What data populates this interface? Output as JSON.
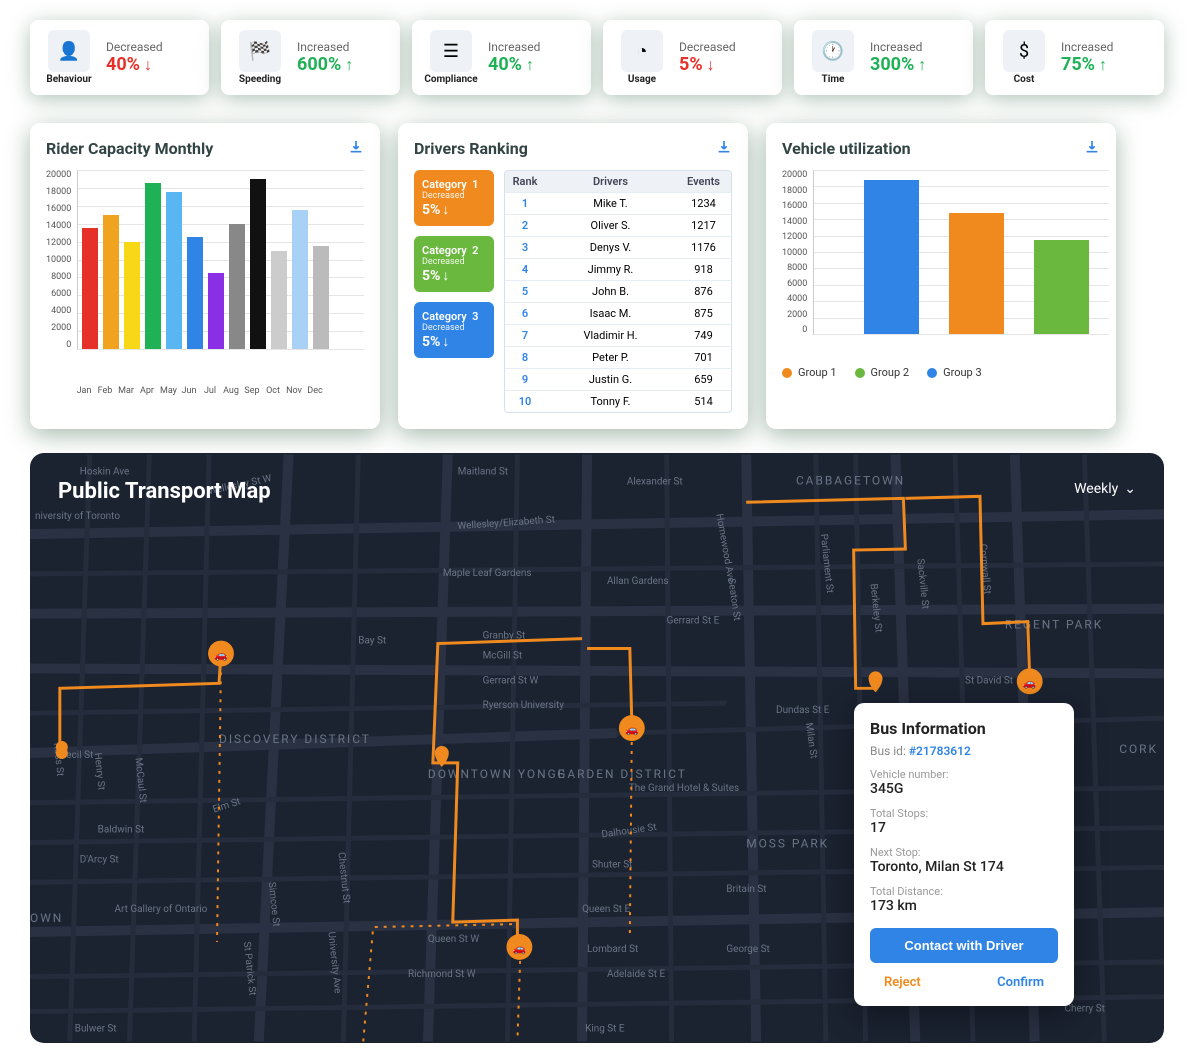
{
  "kpis": [
    {
      "icon": "👤",
      "label": "Behaviour",
      "trend": "Decreased",
      "value": "40%",
      "dir": "down"
    },
    {
      "icon": "🏁",
      "label": "Speeding",
      "trend": "Increased",
      "value": "600%",
      "dir": "up"
    },
    {
      "icon": "☰",
      "label": "Compliance",
      "trend": "Increased",
      "value": "40%",
      "dir": "up"
    },
    {
      "icon": "◔",
      "label": "Usage",
      "trend": "Decreased",
      "value": "5%",
      "dir": "down"
    },
    {
      "icon": "🕐",
      "label": "Time",
      "trend": "Increased",
      "value": "300%",
      "dir": "up"
    },
    {
      "icon": "$",
      "label": "Cost",
      "trend": "Increased",
      "value": "75%",
      "dir": "up"
    }
  ],
  "rider": {
    "title": "Rider Capacity Monthly",
    "ymax": 20000,
    "yticks": [
      "20000",
      "18000",
      "16000",
      "14000",
      "12000",
      "10000",
      "8000",
      "6000",
      "4000",
      "2000",
      "0"
    ],
    "months": [
      "Jan",
      "Feb",
      "Mar",
      "Apr",
      "May",
      "Jun",
      "Jul",
      "Aug",
      "Sep",
      "Oct",
      "Nov",
      "Dec"
    ],
    "values": [
      13500,
      15000,
      12000,
      18500,
      17500,
      12500,
      8500,
      14000,
      19000,
      11000,
      15500,
      11500
    ],
    "colors": [
      "#e6302a",
      "#f0a31e",
      "#f7d716",
      "#1fb155",
      "#59b6f2",
      "#2f84e6",
      "#8b2fe6",
      "#888",
      "#111",
      "#ccc",
      "#a9d0f5",
      "#bbb"
    ]
  },
  "drivers": {
    "title": "Drivers Ranking",
    "categories": [
      {
        "name": "Category",
        "num": "1",
        "trend": "Decreased",
        "value": "5%",
        "cls": "cat1"
      },
      {
        "name": "Category",
        "num": "2",
        "trend": "Decreased",
        "value": "5%",
        "cls": "cat2"
      },
      {
        "name": "Category",
        "num": "3",
        "trend": "Decreased",
        "value": "5%",
        "cls": "cat3"
      }
    ],
    "headers": {
      "rank": "Rank",
      "driver": "Drivers",
      "events": "Events"
    },
    "rows": [
      {
        "rank": "1",
        "driver": "Mike T.",
        "events": "1234"
      },
      {
        "rank": "2",
        "driver": "Oliver S.",
        "events": "1217"
      },
      {
        "rank": "3",
        "driver": "Denys V.",
        "events": "1176"
      },
      {
        "rank": "4",
        "driver": "Jimmy R.",
        "events": "918"
      },
      {
        "rank": "5",
        "driver": "John B.",
        "events": "876"
      },
      {
        "rank": "6",
        "driver": "Isaac M.",
        "events": "875"
      },
      {
        "rank": "7",
        "driver": "Vladimir H.",
        "events": "749"
      },
      {
        "rank": "8",
        "driver": "Peter P.",
        "events": "701"
      },
      {
        "rank": "9",
        "driver": "Justin G.",
        "events": "659"
      },
      {
        "rank": "10",
        "driver": "Tonny F.",
        "events": "514"
      }
    ]
  },
  "vehicle": {
    "title": "Vehicle utilization",
    "ymax": 20000,
    "yticks": [
      "20000",
      "18000",
      "16000",
      "14000",
      "12000",
      "10000",
      "8000",
      "6000",
      "4000",
      "2000",
      "0"
    ],
    "groups": [
      {
        "label": "Group 1",
        "value": 14800,
        "color": "#f08a1e"
      },
      {
        "label": "Group 2",
        "value": 11500,
        "color": "#6bb83f"
      },
      {
        "label": "Group 3",
        "value": 18800,
        "color": "#2f84e6"
      }
    ],
    "bar_order": [
      2,
      0,
      1
    ]
  },
  "map": {
    "title": "Public Transport Map",
    "dropdown": "Weekly",
    "popup": {
      "title": "Bus Information",
      "id_label": "Bus id:",
      "id": "#21783612",
      "vehicle_label": "Vehicle number:",
      "vehicle": "345G",
      "stops_label": "Total Stops:",
      "stops": "17",
      "next_label": "Next Stop:",
      "next": "Toronto, Milan St 174",
      "distance_label": "Total Distance:",
      "distance": "173 km",
      "contact": "Contact with Driver",
      "reject": "Reject",
      "confirm": "Confirm"
    },
    "labels": {
      "cabbagetown": "CABBAGETOWN",
      "regent": "REGENT PARK",
      "cork": "CORK",
      "moss": "MOSS PARK",
      "garden": "GARDEN DISTRICT",
      "downtown": "DOWNTOWN YONGE",
      "discovery": "DISCOVERY DISTRICT",
      "own": "OWN",
      "uoft": "niversity of Toronto",
      "ryerson": "Ryerson University",
      "allan": "Allan Gardens",
      "maple": "Maple Leaf Gardens",
      "grand": "The Grand Hotel & Suites",
      "gallery": "Art Gallery of Ontario"
    }
  },
  "chart_data": [
    {
      "type": "bar",
      "title": "Rider Capacity Monthly",
      "categories": [
        "Jan",
        "Feb",
        "Mar",
        "Apr",
        "May",
        "Jun",
        "Jul",
        "Aug",
        "Sep",
        "Oct",
        "Nov",
        "Dec"
      ],
      "values": [
        13500,
        15000,
        12000,
        18500,
        17500,
        12500,
        8500,
        14000,
        19000,
        11000,
        15500,
        11500
      ],
      "ylim": [
        0,
        20000
      ],
      "xlabel": "",
      "ylabel": ""
    },
    {
      "type": "bar",
      "title": "Vehicle utilization",
      "categories": [
        "Group 3",
        "Group 1",
        "Group 2"
      ],
      "values": [
        18800,
        14800,
        11500
      ],
      "ylim": [
        0,
        20000
      ],
      "xlabel": "",
      "ylabel": ""
    }
  ]
}
